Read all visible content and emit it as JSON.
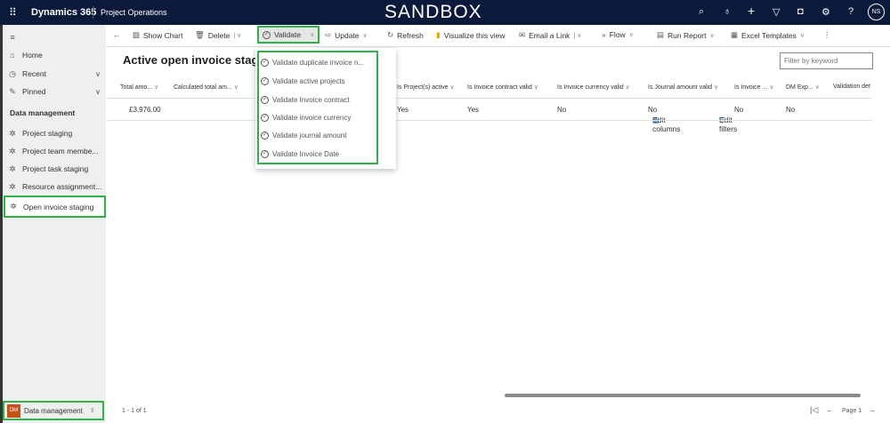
{
  "header": {
    "brand": "Dynamics 365",
    "app": "Project Operations",
    "env": "SANDBOX",
    "avatar": "NS"
  },
  "sidebar": {
    "home": "Home",
    "recent": "Recent",
    "pinned": "Pinned",
    "section": "Data management",
    "items": [
      {
        "label": "Project staging"
      },
      {
        "label": "Project team membe..."
      },
      {
        "label": "Project task staging"
      },
      {
        "label": "Resource assignment..."
      },
      {
        "label": "Open invoice staging"
      }
    ],
    "area": {
      "badge": "DM",
      "label": "Data management"
    }
  },
  "commands": {
    "show_chart": "Show Chart",
    "delete": "Delete",
    "validate": "Validate",
    "update": "Update",
    "refresh": "Refresh",
    "visualize": "Visualize this view",
    "email": "Email a Link",
    "flow": "Flow",
    "run_report": "Run Report",
    "excel": "Excel Templates"
  },
  "view": {
    "title": "Active open invoice staging*",
    "edit_columns": "Edit columns",
    "edit_filters": "Edit filters",
    "filter_placeholder": "Filter by keyword"
  },
  "validate_menu": [
    "Validate duplicate invoice n...",
    "Validate active projects",
    "Validate Invoice contract",
    "Validate invoice currency",
    "Validate journal amount",
    "Validate Invoice Date"
  ],
  "grid": {
    "columns": [
      "Total amo...",
      "Calculated total am...",
      "Is Project(s) active",
      "Is Invoice contract valid",
      "Is Invoice currency valid",
      "Is Journal amount valid",
      "Is Invoice ...",
      "DM Exp...",
      "Validation det"
    ],
    "rows": [
      [
        "£3,976.00",
        "",
        "Yes",
        "Yes",
        "No",
        "No",
        "No",
        "No",
        ""
      ]
    ]
  },
  "footer": {
    "count": "1 - 1 of 1",
    "page": "Page 1"
  }
}
